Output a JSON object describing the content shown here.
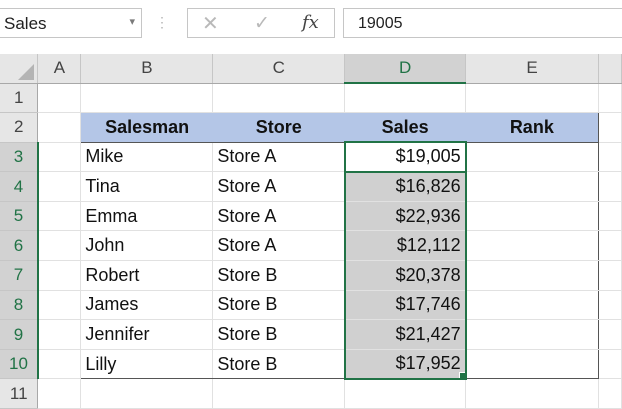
{
  "formula_bar": {
    "name_box": "Sales",
    "cancel_icon": "cancel-icon",
    "enter_icon": "check-icon",
    "fx_label": "fx",
    "value": "19005"
  },
  "columns": [
    "A",
    "B",
    "C",
    "D",
    "E"
  ],
  "rows": [
    "1",
    "2",
    "3",
    "4",
    "5",
    "6",
    "7",
    "8",
    "9",
    "10",
    "11"
  ],
  "table": {
    "headers": [
      "Salesman",
      "Store",
      "Sales",
      "Rank"
    ],
    "data": [
      {
        "name": "Mike",
        "store": "Store A",
        "sales": "$19,005",
        "rank": ""
      },
      {
        "name": "Tina",
        "store": "Store A",
        "sales": "$16,826",
        "rank": ""
      },
      {
        "name": "Emma",
        "store": "Store A",
        "sales": "$22,936",
        "rank": ""
      },
      {
        "name": "John",
        "store": "Store A",
        "sales": "$12,112",
        "rank": ""
      },
      {
        "name": "Robert",
        "store": "Store B",
        "sales": "$20,378",
        "rank": ""
      },
      {
        "name": "James",
        "store": "Store B",
        "sales": "$17,746",
        "rank": ""
      },
      {
        "name": "Jennifer",
        "store": "Store B",
        "sales": "$21,427",
        "rank": ""
      },
      {
        "name": "Lilly",
        "store": "Store B",
        "sales": "$17,952",
        "rank": ""
      }
    ]
  },
  "colors": {
    "header_fill": "#b4c6e7",
    "selection_accent": "#217346",
    "selection_shade": "#d0d0d0"
  }
}
